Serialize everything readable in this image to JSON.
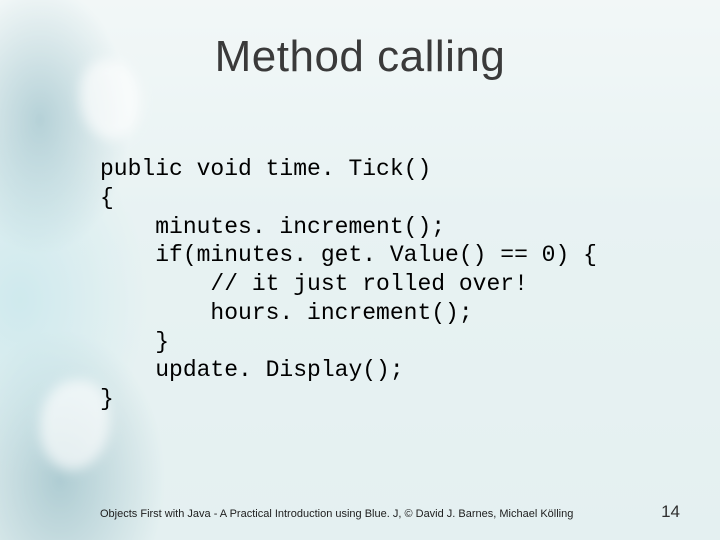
{
  "title": "Method calling",
  "code": "public void time. Tick()\n{\n    minutes. increment();\n    if(minutes. get. Value() == 0) {\n        // it just rolled over!\n        hours. increment();\n    }\n    update. Display();\n}",
  "footer": "Objects First with Java - A Practical Introduction using Blue. J, © David J. Barnes, Michael Kölling",
  "page_number": "14"
}
